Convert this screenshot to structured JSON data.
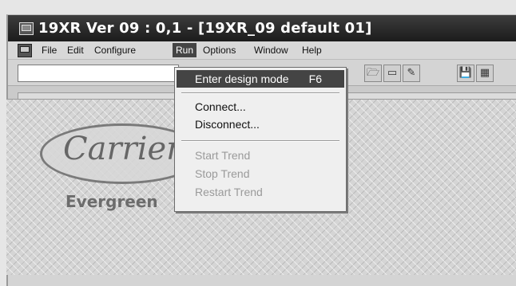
{
  "window": {
    "title": "19XR Ver 09 : 0,1 - [19XR_09 default 01]"
  },
  "menubar": {
    "items": [
      {
        "label": "File"
      },
      {
        "label": "Edit"
      },
      {
        "label": "Configure"
      },
      {
        "label": "Run"
      },
      {
        "label": "Options"
      },
      {
        "label": "Window"
      },
      {
        "label": "Help"
      }
    ],
    "active": "Run"
  },
  "toolbar": {
    "combo_value": ""
  },
  "run_menu": {
    "items": [
      {
        "label": "Enter design mode",
        "shortcut": "F6",
        "state": "highlighted"
      },
      {
        "label": "Connect...",
        "state": "enabled"
      },
      {
        "label": "Disconnect...",
        "state": "enabled"
      },
      {
        "label": "Start Trend",
        "state": "disabled"
      },
      {
        "label": "Stop Trend",
        "state": "disabled"
      },
      {
        "label": "Restart Trend",
        "state": "disabled"
      }
    ]
  },
  "branding": {
    "logo": "Carrier",
    "tagline": "Evergreen"
  },
  "colors": {
    "titlebar": "#2a2a2a",
    "highlight": "#444444",
    "workspace": "#d5d5d5"
  },
  "icons": [
    "app-icon",
    "open-folder-icon",
    "window-icon",
    "edit-icon",
    "save-icon",
    "grid-icon"
  ]
}
